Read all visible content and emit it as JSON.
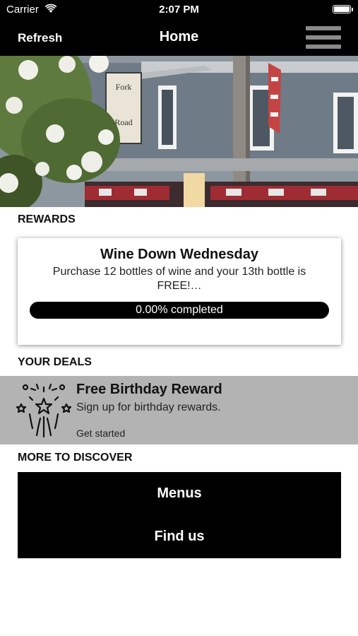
{
  "status_bar": {
    "carrier": "Carrier",
    "time": "2:07 PM"
  },
  "nav": {
    "refresh_label": "Refresh",
    "title": "Home",
    "menu_icon": "hamburger-menu-icon"
  },
  "hero": {
    "sign_line1": "Fork",
    "sign_line2": "Road"
  },
  "rewards": {
    "section_label": "REWARDS",
    "card": {
      "title": "Wine Down Wednesday",
      "description": "Purchase 12 bottles of wine and your 13th bottle is FREE!…",
      "progress_text": "0.00% completed",
      "progress_fraction": 0.0
    }
  },
  "deals": {
    "section_label": "YOUR DEALS",
    "items": [
      {
        "icon": "fireworks-icon",
        "title": "Free Birthday Reward",
        "subtitle": "Sign up for birthday rewards.",
        "link": "Get started"
      }
    ]
  },
  "discover": {
    "section_label": "MORE TO DISCOVER",
    "buttons": [
      {
        "label": "Menus"
      },
      {
        "label": "Find us"
      }
    ]
  },
  "colors": {
    "bar_background": "#000000",
    "deal_background": "#b3b3b3",
    "menu_icon_color": "#8a8a8a"
  }
}
